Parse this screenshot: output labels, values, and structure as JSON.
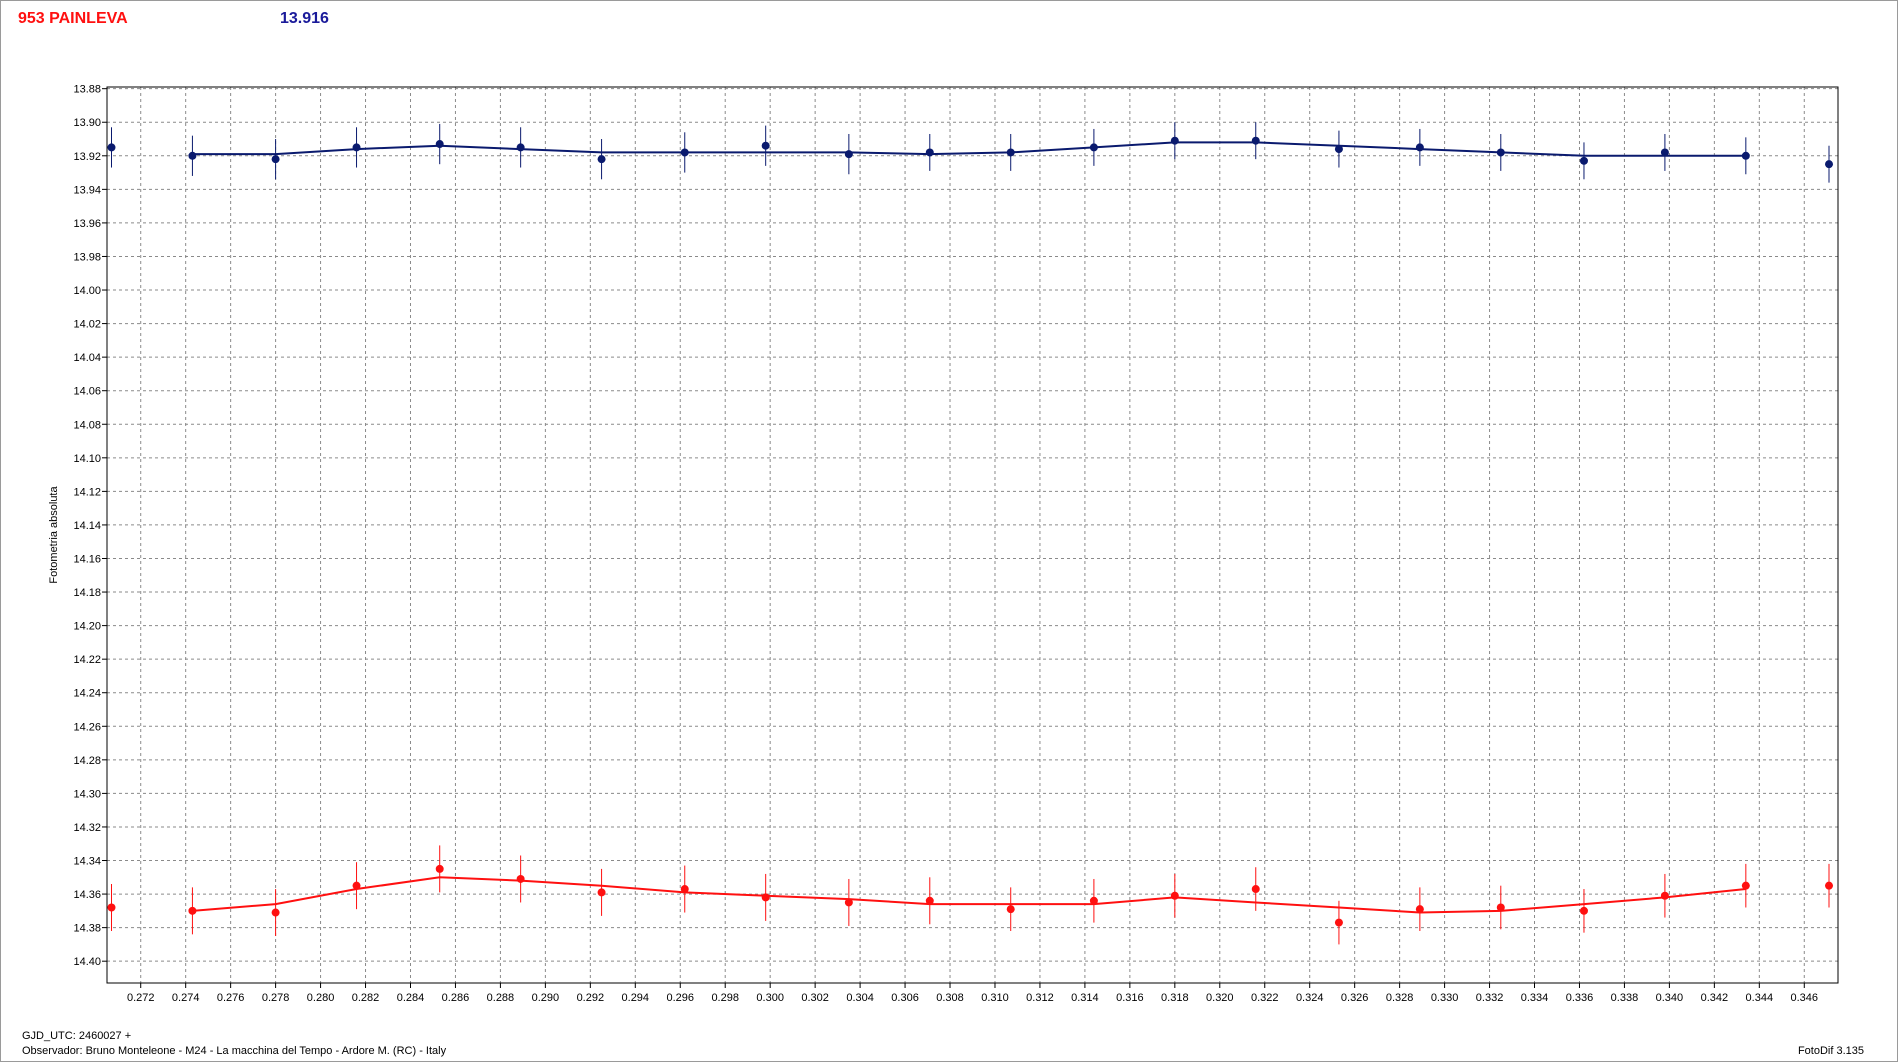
{
  "header": {
    "object_name": "953 PAINLEVA",
    "mean_magnitude": "13.916"
  },
  "footer": {
    "gjd": "GJD_UTC: 2460027 +",
    "observer": "Observador: Bruno Monteleone - M24 - La macchina del Tempo - Ardore M. (RC) - Italy",
    "software": "FotoDif 3.135"
  },
  "chart_data": {
    "type": "scatter",
    "ylabel": "Fotometria absoluta",
    "xlabel": "",
    "xlim": [
      0.2705,
      0.3475
    ],
    "ylim": [
      13.879,
      14.413
    ],
    "y_inverted": true,
    "grid": true,
    "x_ticks": [
      0.272,
      0.274,
      0.276,
      0.278,
      0.28,
      0.282,
      0.284,
      0.286,
      0.288,
      0.29,
      0.292,
      0.294,
      0.296,
      0.298,
      0.3,
      0.302,
      0.304,
      0.306,
      0.308,
      0.31,
      0.312,
      0.314,
      0.316,
      0.318,
      0.32,
      0.322,
      0.324,
      0.326,
      0.328,
      0.33,
      0.332,
      0.334,
      0.336,
      0.338,
      0.34,
      0.342,
      0.344,
      0.346
    ],
    "x_tick_labels": [
      "0.272",
      "0.274",
      "0.276",
      "0.278",
      "0.280",
      "0.282",
      "0.284",
      "0.286",
      "0.288",
      "0.290",
      "0.292",
      "0.294",
      "0.296",
      "0.298",
      "0.300",
      "0.302",
      "0.304",
      "0.306",
      "0.308",
      "0.310",
      "0.312",
      "0.314",
      "0.316",
      "0.318",
      "0.320",
      "0.322",
      "0.324",
      "0.326",
      "0.328",
      "0.330",
      "0.332",
      "0.334",
      "0.336",
      "0.338",
      "0.340",
      "0.342",
      "0.344",
      "0.346"
    ],
    "y_ticks": [
      13.88,
      13.9,
      13.92,
      13.94,
      13.96,
      13.98,
      14.0,
      14.02,
      14.04,
      14.06,
      14.08,
      14.1,
      14.12,
      14.14,
      14.16,
      14.18,
      14.2,
      14.22,
      14.24,
      14.26,
      14.28,
      14.3,
      14.32,
      14.34,
      14.36,
      14.38,
      14.4
    ],
    "y_tick_labels": [
      "13.88",
      "13.90",
      "13.92",
      "13.94",
      "13.96",
      "13.98",
      "14.00",
      "14.02",
      "14.04",
      "14.06",
      "14.08",
      "14.10",
      "14.12",
      "14.14",
      "14.16",
      "14.18",
      "14.20",
      "14.22",
      "14.24",
      "14.26",
      "14.28",
      "14.30",
      "14.32",
      "14.34",
      "14.36",
      "14.38",
      "14.40"
    ],
    "series": [
      {
        "color": "#0a1a6e",
        "x": [
          0.2707,
          0.2743,
          0.278,
          0.2816,
          0.2853,
          0.2889,
          0.2925,
          0.2962,
          0.2998,
          0.3035,
          0.3071,
          0.3107,
          0.3144,
          0.318,
          0.3216,
          0.3253,
          0.3289,
          0.3325,
          0.3362,
          0.3398,
          0.3434,
          0.3471
        ],
        "y": [
          13.915,
          13.92,
          13.922,
          13.915,
          13.913,
          13.915,
          13.922,
          13.918,
          13.914,
          13.919,
          13.918,
          13.918,
          13.915,
          13.911,
          13.911,
          13.916,
          13.915,
          13.918,
          13.923,
          13.918,
          13.92,
          13.925
        ],
        "err": [
          0.012,
          0.012,
          0.012,
          0.012,
          0.012,
          0.012,
          0.012,
          0.012,
          0.012,
          0.012,
          0.011,
          0.011,
          0.011,
          0.011,
          0.011,
          0.011,
          0.011,
          0.011,
          0.011,
          0.011,
          0.011,
          0.011
        ],
        "fit_x": [
          0.2743,
          0.278,
          0.2816,
          0.2853,
          0.2889,
          0.2925,
          0.2962,
          0.2998,
          0.3035,
          0.3071,
          0.3107,
          0.3144,
          0.318,
          0.3216,
          0.3253,
          0.3289,
          0.3325,
          0.3362,
          0.3398,
          0.3434
        ],
        "fit_y": [
          13.919,
          13.919,
          13.916,
          13.914,
          13.916,
          13.918,
          13.918,
          13.918,
          13.918,
          13.919,
          13.918,
          13.915,
          13.912,
          13.912,
          13.914,
          13.916,
          13.918,
          13.92,
          13.92,
          13.92
        ]
      },
      {
        "color": "#ff1010",
        "x": [
          0.2707,
          0.2743,
          0.278,
          0.2816,
          0.2853,
          0.2889,
          0.2925,
          0.2962,
          0.2998,
          0.3035,
          0.3071,
          0.3107,
          0.3144,
          0.318,
          0.3216,
          0.3253,
          0.3289,
          0.3325,
          0.3362,
          0.3398,
          0.3434,
          0.3471
        ],
        "y": [
          14.368,
          14.37,
          14.371,
          14.355,
          14.345,
          14.351,
          14.359,
          14.357,
          14.362,
          14.365,
          14.364,
          14.369,
          14.364,
          14.361,
          14.357,
          14.377,
          14.369,
          14.368,
          14.37,
          14.361,
          14.355,
          14.355
        ],
        "err": [
          0.014,
          0.014,
          0.014,
          0.014,
          0.014,
          0.014,
          0.014,
          0.014,
          0.014,
          0.014,
          0.014,
          0.013,
          0.013,
          0.013,
          0.013,
          0.013,
          0.013,
          0.013,
          0.013,
          0.013,
          0.013,
          0.013
        ],
        "fit_x": [
          0.2743,
          0.278,
          0.2816,
          0.2853,
          0.2889,
          0.2925,
          0.2962,
          0.2998,
          0.3035,
          0.3071,
          0.3107,
          0.3144,
          0.318,
          0.3216,
          0.3253,
          0.3289,
          0.3325,
          0.3362,
          0.3398,
          0.3434
        ],
        "fit_y": [
          14.37,
          14.366,
          14.357,
          14.35,
          14.352,
          14.355,
          14.359,
          14.361,
          14.363,
          14.366,
          14.366,
          14.366,
          14.362,
          14.365,
          14.368,
          14.371,
          14.37,
          14.366,
          14.362,
          14.357
        ]
      }
    ]
  }
}
